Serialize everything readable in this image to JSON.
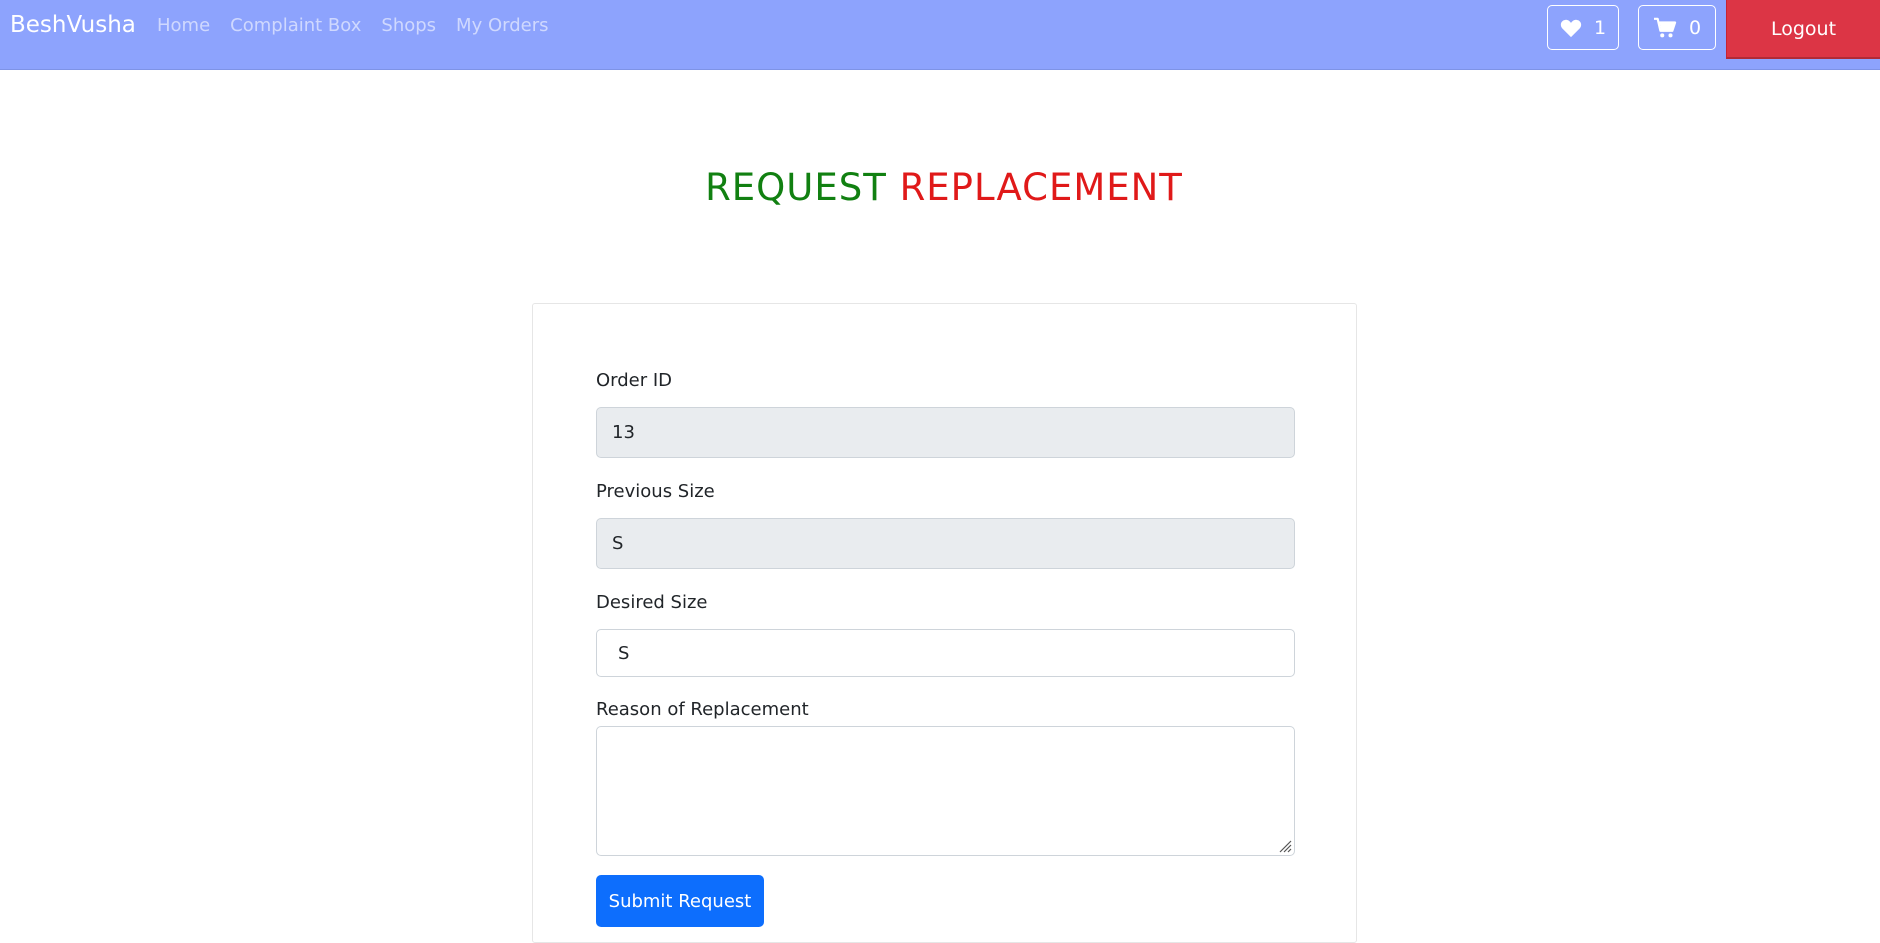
{
  "navbar": {
    "brand": "BeshVusha",
    "links": [
      "Home",
      "Complaint Box",
      "Shops",
      "My Orders"
    ],
    "wishlist_count": "1",
    "cart_count": "0",
    "logout_label": "Logout",
    "wishlist_icon": "heart-icon",
    "cart_icon": "cart-icon"
  },
  "title": {
    "part1": "REQUEST",
    "part2": "REPLACEMENT"
  },
  "form": {
    "order_id_label": "Order ID",
    "order_id_value": "13",
    "previous_size_label": "Previous Size",
    "previous_size_value": "S",
    "desired_size_label": "Desired Size",
    "desired_size_value": "S",
    "reason_label": "Reason of Replacement",
    "reason_value": "",
    "submit_label": "Submit Request"
  },
  "colors": {
    "navbar_bg": "#8da3fd",
    "logout_bg": "#dc3545",
    "title_green": "#118011",
    "title_red": "#e01919",
    "submit_bg": "#0d6efd",
    "readonly_bg": "#e9ecef"
  }
}
